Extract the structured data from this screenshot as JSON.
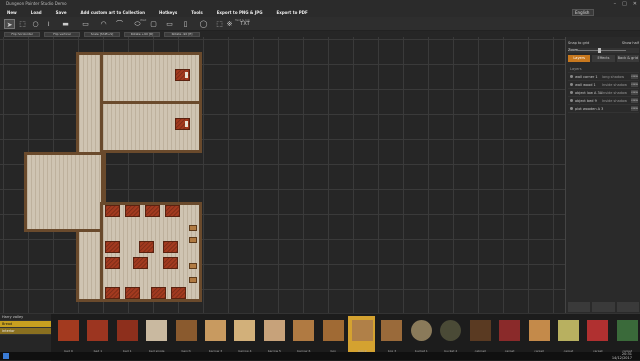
{
  "window": {
    "title": "Dungeon Painter Studio Demo",
    "controls": [
      "–",
      "□",
      "✕"
    ]
  },
  "menu": {
    "items": [
      "New",
      "Load",
      "Save",
      "Add custom art to Collection",
      "Hotkeys",
      "Tools",
      "Export to PNG & JPG",
      "Export to PDF"
    ],
    "language": "English"
  },
  "toolbar": {
    "groups": [
      "Edit",
      "Wall",
      "Text & Ink"
    ],
    "tool_icons": [
      "pointer-icon",
      "rect-select-icon",
      "circle-icon",
      "zigzag-icon",
      "wall-thin-icon",
      "wall-thick-icon",
      "hill-icon",
      "arch-icon",
      "oval-icon",
      "box-icon",
      "rect-icon",
      "rect-thin-icon",
      "ring-icon",
      "dashed-rect-icon",
      "stamp-icon",
      "text-icon"
    ],
    "text_tool_label": "TXT"
  },
  "subtoolbar": {
    "buttons": [
      "Flip horizontal",
      "Flip vertical",
      "Scale [Shift+S]",
      "Rotate +90 [R]",
      "Rotate -90 [E]"
    ]
  },
  "right_panel": {
    "snap_label": "Snap to grid",
    "hide_label": "Show half",
    "zoom_label": "Zoom",
    "tabs": [
      "Layers",
      "Effects",
      "Back & grid"
    ],
    "active_tab": "Layers",
    "section_label": "Layers",
    "layers": [
      {
        "name": "wall corner 1",
        "mode": "long shadow",
        "action": "view"
      },
      {
        "name": "wall wood 1",
        "mode": "Inside shadow",
        "action": "view"
      },
      {
        "name": "object low A 3A",
        "mode": "Inside shadow",
        "action": "view"
      },
      {
        "name": "object bed 9",
        "mode": "Inside shadow",
        "action": "view"
      },
      {
        "name": "plot wooden A 3",
        "mode": "",
        "action": "view"
      }
    ]
  },
  "asset_bar": {
    "categories": [
      "Harry valley",
      "Bread",
      "interior"
    ],
    "bottom_buttons": [
      "Sets",
      "Search",
      "Table"
    ],
    "thumbs": [
      {
        "caption": "bed 9",
        "color": "#a33a1f",
        "icon": "bed-icon"
      },
      {
        "caption": "bed 1",
        "color": "#9c3520",
        "icon": "bed-icon"
      },
      {
        "caption": "bed 1",
        "color": "#8d2f1c",
        "icon": "bed-icon"
      },
      {
        "caption": "bed single",
        "color": "#c9b9a0",
        "icon": "bed-icon"
      },
      {
        "caption": "bench",
        "color": "#8a5a2e",
        "icon": "bench-icon"
      },
      {
        "caption": "barrow 3",
        "color": "#c89a60",
        "icon": "scroll-icon"
      },
      {
        "caption": "barrow 4",
        "color": "#d2b07a",
        "icon": "scroll-icon"
      },
      {
        "caption": "barrow 5",
        "color": "#c7a27a",
        "icon": "scroll-icon"
      },
      {
        "caption": "barrow 6",
        "color": "#b07a42",
        "icon": "barrel-icon"
      },
      {
        "caption": "box",
        "color": "#a06a34",
        "icon": "crate-icon"
      },
      {
        "caption": "box 2",
        "color": "#b08048",
        "icon": "crate-icon"
      },
      {
        "caption": "box 3",
        "color": "#9a6a3a",
        "icon": "crate-icon"
      },
      {
        "caption": "bucket 1",
        "color": "#8a7a5a",
        "icon": "bucket-icon"
      },
      {
        "caption": "bucket 2",
        "color": "#4a4a36",
        "icon": "bucket-icon"
      },
      {
        "caption": "cabinet",
        "color": "#5a3a22",
        "icon": "cabinet-icon"
      },
      {
        "caption": "carpet",
        "color": "#8a2a2a",
        "icon": "carpet-icon"
      },
      {
        "caption": "carpet",
        "color": "#c48a4a",
        "icon": "carpet-icon"
      },
      {
        "caption": "carpet",
        "color": "#b8b060",
        "icon": "carpet-icon"
      },
      {
        "caption": "carpet",
        "color": "#b03030",
        "icon": "carpet-icon"
      },
      {
        "caption": "carpet",
        "color": "#3a6a3a",
        "icon": "carpet-icon"
      }
    ],
    "selected_index": 10
  },
  "taskbar": {
    "time": "20:31",
    "date": "14/12/2017"
  },
  "colors": {
    "accent": "#c8781e",
    "selection": "#d4a230",
    "floor": "#cfc4b2",
    "wall": "#6a4a2c",
    "bed": "#a33a1f"
  }
}
